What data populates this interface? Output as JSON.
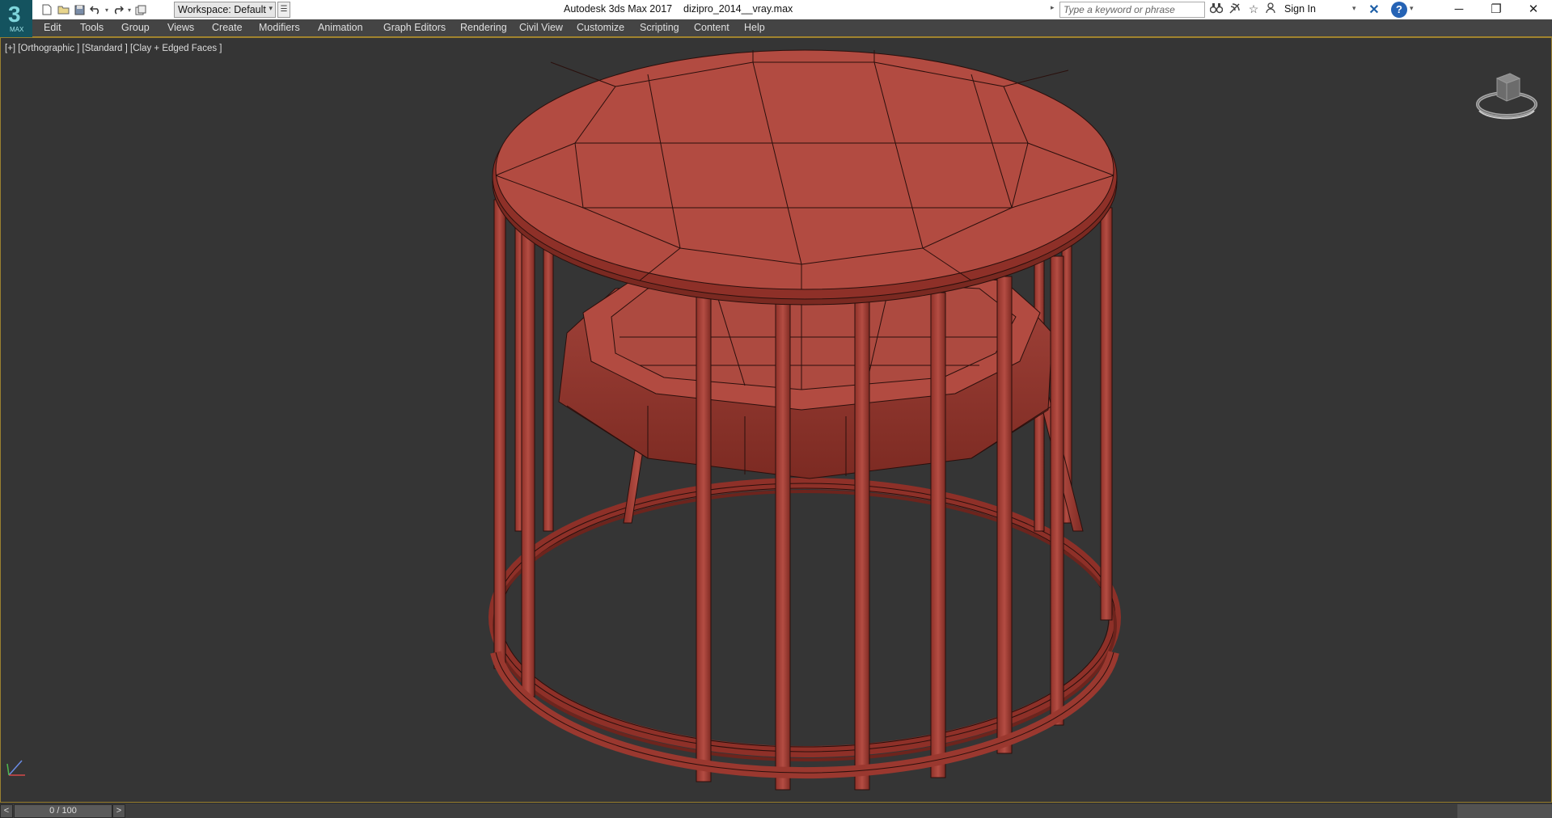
{
  "app": {
    "logo_text": "3",
    "logo_sub": "MAX",
    "title": "Autodesk 3ds Max 2017",
    "filename": "dizipro_2014__vray.max"
  },
  "toolbar": {
    "workspace_label": "Workspace: Default",
    "search_placeholder": "Type a keyword or phrase",
    "sign_in_label": "Sign In",
    "help_label": "?"
  },
  "menu": {
    "items": [
      {
        "label": "Edit"
      },
      {
        "label": "Tools"
      },
      {
        "label": "Group"
      },
      {
        "label": "Views"
      },
      {
        "label": "Create"
      },
      {
        "label": "Modifiers"
      },
      {
        "label": "Animation"
      },
      {
        "label": "Graph Editors"
      },
      {
        "label": "Rendering"
      },
      {
        "label": "Civil View"
      },
      {
        "label": "Customize"
      },
      {
        "label": "Scripting"
      },
      {
        "label": "Content"
      },
      {
        "label": "Help"
      }
    ]
  },
  "viewport": {
    "label": "[+] [Orthographic ] [Standard ] [Clay + Edged Faces ]",
    "model_color": "#b24b41",
    "edge_color": "#2a0f0c",
    "background": "#353535"
  },
  "timeline": {
    "prev": "<",
    "frame_display": "0 / 100",
    "next": ">",
    "current_frame": 0,
    "total_frames": 100
  },
  "icons": {
    "new": "new-file-icon",
    "open": "open-file-icon",
    "save": "save-icon",
    "undo": "undo-icon",
    "redo": "redo-icon",
    "project": "project-folder-icon",
    "binoculars": "binoculars-icon",
    "satellite": "communication-center-icon",
    "star": "favorites-star-icon",
    "user": "user-icon",
    "exchange": "autodesk-exchange-icon"
  }
}
